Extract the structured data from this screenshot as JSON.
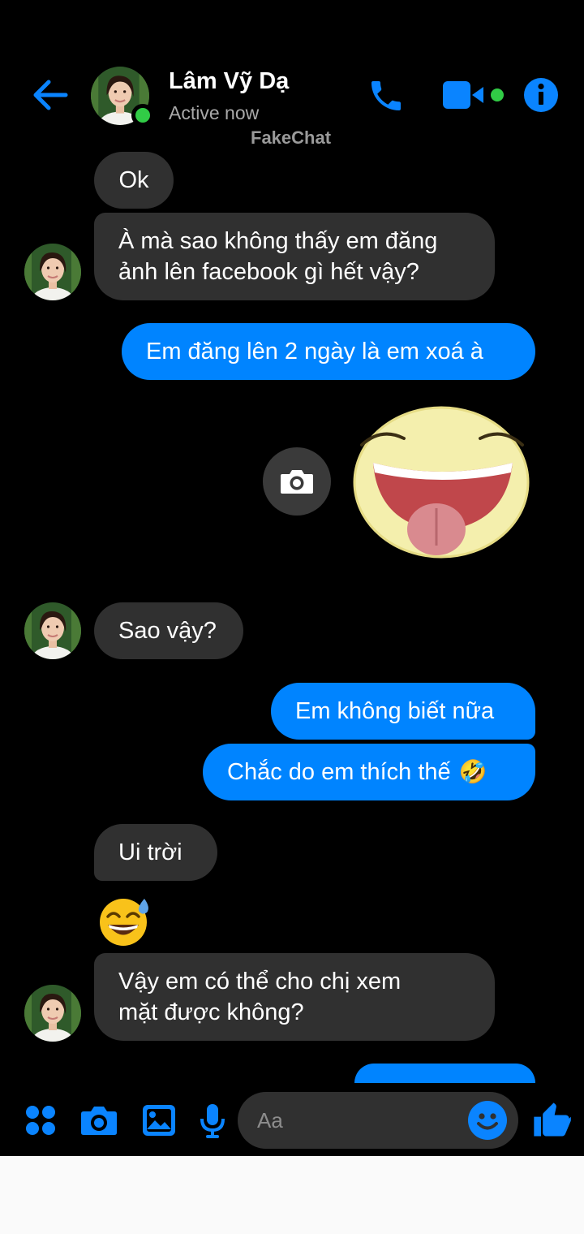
{
  "header": {
    "contact_name": "Lâm Vỹ Dạ",
    "status": "Active now",
    "watermark": "FakeChat",
    "icons": [
      "back-arrow-icon",
      "phone-icon",
      "video-camera-icon",
      "info-icon"
    ]
  },
  "messages": [
    {
      "direction": "incoming",
      "text": "Ok"
    },
    {
      "direction": "incoming",
      "lines": [
        "À mà sao không thấy em đăng",
        "ảnh lên facebook gì hết vậy?"
      ]
    },
    {
      "direction": "outgoing",
      "text": "Em đăng lên 2 ngày là em xoá à"
    },
    {
      "direction": "outgoing",
      "sticker": "laughing-tongue-face-sticker"
    },
    {
      "direction": "incoming",
      "text": "Sao vậy?"
    },
    {
      "direction": "outgoing",
      "text": "Em không biết nữa"
    },
    {
      "direction": "outgoing",
      "text": "Chắc do em thích thế",
      "emoji": "🤣"
    },
    {
      "direction": "incoming",
      "text": "Ui trời"
    },
    {
      "direction": "incoming",
      "emoji": "😅"
    },
    {
      "direction": "incoming",
      "lines": [
        "Vậy em có thể cho chị xem",
        "mặt được không?"
      ]
    }
  ],
  "composer": {
    "placeholder": "Aa",
    "icons": [
      "apps-icon",
      "camera-icon",
      "gallery-icon",
      "microphone-icon",
      "emoji-icon",
      "thumbs-up-icon"
    ]
  },
  "colors": {
    "accent": "#0084ff",
    "background": "#000000",
    "incoming_bubble": "#303030",
    "outgoing_bubble": "#0084ff",
    "online": "#31cc46"
  }
}
